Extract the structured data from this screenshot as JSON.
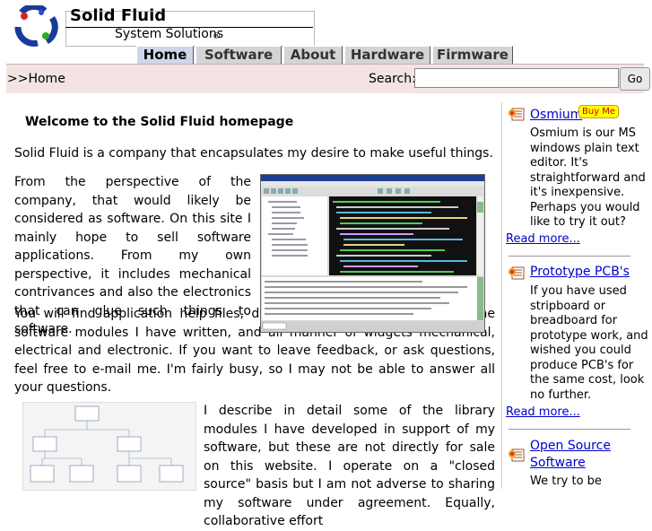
{
  "brand": {
    "title": "Solid Fluid",
    "subtitle": "System Solutions",
    "reg": "®"
  },
  "nav": {
    "tabs": [
      "Home",
      "Software",
      "About",
      "Hardware",
      "Firmware"
    ]
  },
  "bar": {
    "breadcrumb": ">>Home",
    "search_label": "Search:",
    "search_value": "",
    "go_label": "Go"
  },
  "main": {
    "heading": "Welcome to the Solid Fluid homepage",
    "p1": "Solid Fluid is a company that encapsulates my desire to make useful things.",
    "p2": "From the perspective of the company, that would likely be considered as software. On this site I mainly hope to sell software applications. From my own perspective, it includes mechanical contrivances and also the electronics that can glue such things to software.",
    "p3": "You will find application help files, detailed descriptions of some of the software modules I have written, and all manner of widgets mechanical, electrical and electronic. If you want to leave feedback, or ask questions, feel free to e-mail me. I'm fairly busy, so I may not be able to answer all your questions.",
    "p4": "I describe in detail some of the library modules I have developed in support of my software, but these are not directly for sale on this website. I operate on a \"closed source\" basis but I am not adverse to sharing my software under agreement. Equally, collaborative effort"
  },
  "sidebar": {
    "items": [
      {
        "title": "Osmium",
        "badge": "Buy Me",
        "text": "Osmium is our MS windows plain text editor. It's straightforward and it's inexpensive. Perhaps you would like to try it out?",
        "more": "Read more..."
      },
      {
        "title": "Prototype PCB's",
        "text": "If you have used stripboard or breadboard for prototype work, and wished you could produce PCB's for the same cost, look no further.",
        "more": "Read more..."
      },
      {
        "title": "Open Source Software",
        "text": "We try to be"
      }
    ]
  },
  "colors": {
    "accent": "#cfd6e8",
    "bar_bg": "#f3e3e3",
    "link": "#0000cc"
  }
}
